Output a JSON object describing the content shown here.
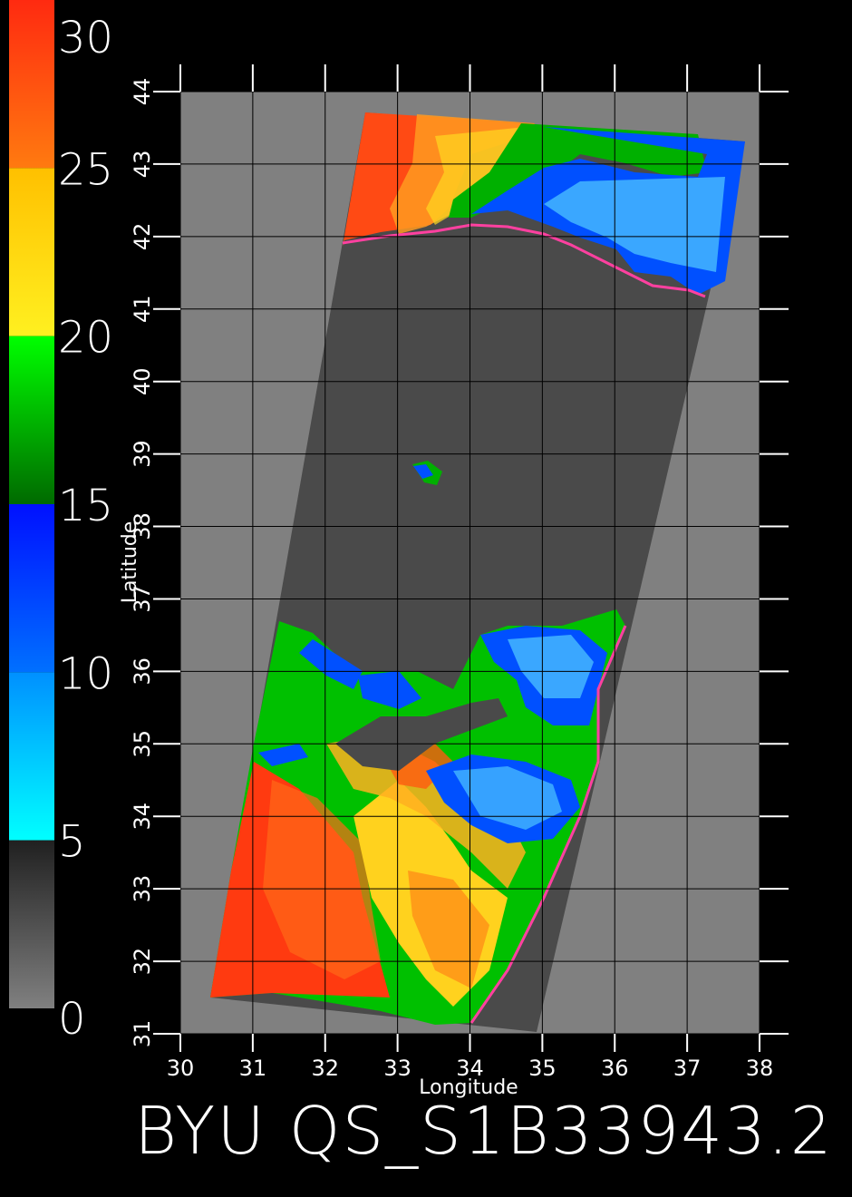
{
  "map": {
    "title": "BYU QS_S1B33943.2",
    "xlabel": "Longitude",
    "ylabel": "Latitude",
    "lon_ticks": [
      "30",
      "31",
      "32",
      "33",
      "34",
      "35",
      "36",
      "37",
      "38"
    ],
    "lat_ticks": [
      "31",
      "32",
      "33",
      "34",
      "35",
      "36",
      "37",
      "38",
      "39",
      "40",
      "41",
      "42",
      "43",
      "44"
    ],
    "lon_range": [
      30,
      38
    ],
    "lat_range": [
      31,
      44
    ]
  },
  "colorbar": {
    "labels": [
      "30",
      "25",
      "20",
      "15",
      "10",
      "5",
      "0"
    ],
    "values": [
      30,
      25,
      20,
      15,
      10,
      5,
      0
    ],
    "segments": [
      {
        "from": 25,
        "to": 30,
        "top": "#ff2a10",
        "bottom": "#ff7a10"
      },
      {
        "from": 20,
        "to": 25,
        "top": "#ffc000",
        "bottom": "#fff020"
      },
      {
        "from": 15,
        "to": 20,
        "top": "#00ff00",
        "bottom": "#006a00"
      },
      {
        "from": 10,
        "to": 15,
        "top": "#0010ff",
        "bottom": "#0070ff"
      },
      {
        "from": 5,
        "to": 10,
        "top": "#0090ff",
        "bottom": "#00ffff"
      },
      {
        "from": 0,
        "to": 5,
        "top": "#202020",
        "bottom": "#808080"
      }
    ]
  },
  "colors": {
    "background": "#000000",
    "ocean_outside": "#808080",
    "land_swath": "#4a4a4a",
    "grid": "#000000"
  }
}
